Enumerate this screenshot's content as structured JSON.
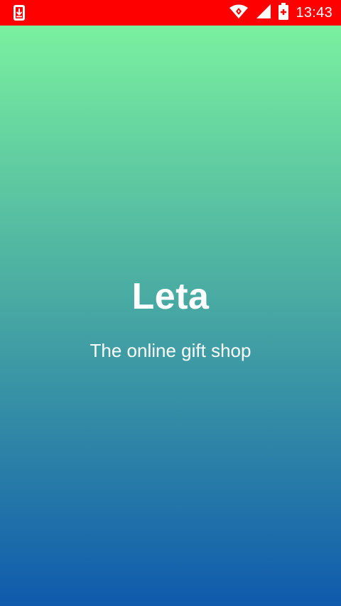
{
  "status_bar": {
    "time": "13:43",
    "background_color": "#ff0000",
    "icons": [
      "download-notification-icon",
      "wifi-icon",
      "signal-icon",
      "battery-icon"
    ]
  },
  "splash": {
    "title": "Leta",
    "subtitle": "The online gift shop",
    "gradient_top_color": "#7af09f",
    "gradient_bottom_color": "#0f5aac"
  }
}
